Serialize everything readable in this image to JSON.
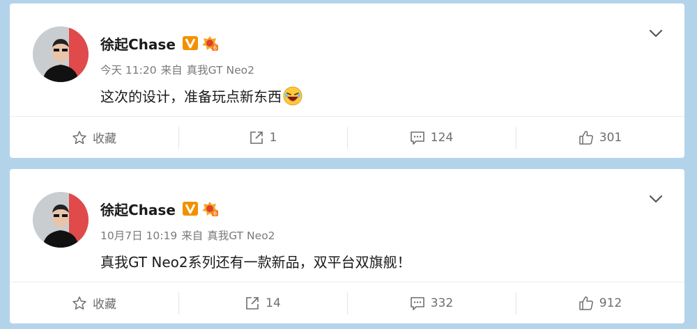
{
  "posts": [
    {
      "user_name": "徐起Chase",
      "time": "今天 11:20",
      "source_prefix": "来自",
      "source": "真我GT Neo2",
      "content": "这次的设计，准备玩点新东西",
      "actions": {
        "favorite": "收藏",
        "repost": "1",
        "comment": "124",
        "like": "301"
      }
    },
    {
      "user_name": "徐起Chase",
      "time": "10月7日 10:19",
      "source_prefix": "来自",
      "source": "真我GT Neo2",
      "content": "真我GT Neo2系列还有一款新品，双平台双旗舰！",
      "actions": {
        "favorite": "收藏",
        "repost": "14",
        "comment": "332",
        "like": "912"
      }
    }
  ],
  "icons": {
    "verified": "verified-v-icon",
    "level": "user-level-icon",
    "emoji": "laughing-emoji-icon",
    "menu": "chevron-down-icon",
    "favorite": "star-icon",
    "repost": "share-arrow-icon",
    "comment": "comment-bubble-icon",
    "like": "thumbs-up-icon"
  },
  "colors": {
    "background": "#b3d3ea",
    "verified": "#f29100",
    "name": "#1a1a1a",
    "meta": "#7a7a7a"
  }
}
